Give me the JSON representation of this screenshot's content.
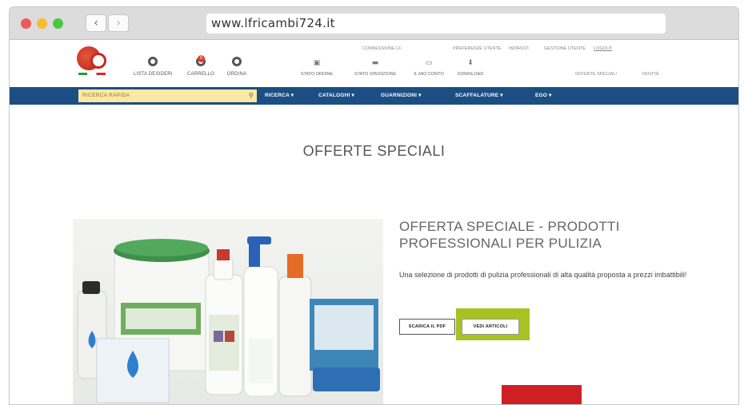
{
  "browser": {
    "url": "www.lfricambi724.it",
    "back_icon": "‹",
    "forward_icon": "›",
    "colors": {
      "close": "#ee5b55",
      "minimize": "#f6bd2f",
      "zoom": "#4bc742"
    }
  },
  "header": {
    "icons": [
      {
        "label": "LISTA DESIDERI"
      },
      {
        "label": "CARRELLO",
        "badge": "0"
      },
      {
        "label": "ORDINA"
      }
    ],
    "status_icons": [
      {
        "label": "STATO ORDINE"
      },
      {
        "label": "STATO SPEDIZIONE"
      },
      {
        "label": "IL MIO CONTO"
      },
      {
        "label": "DOWNLOAD"
      }
    ],
    "top_links": [
      "CONNESSIONE LF",
      "PREFERENZE UTENTE",
      "INDIRIZZI",
      "GESTIONE UTENTE",
      "LOGOUT"
    ],
    "right_links": [
      "OFFERTE SPECIALI",
      "NOVITÀ"
    ]
  },
  "menu": {
    "search_placeholder": "RICERCA RAPIDA",
    "items": [
      "RICERCA ▾",
      "CATALOGHI ▾",
      "GUARNIZIONI ▾",
      "SCAFFALATURE ▾",
      "EGO ▾"
    ],
    "color": "#1b4f83"
  },
  "page": {
    "title": "OFFERTE SPECIALI",
    "offer": {
      "title": "OFFERTA SPECIALE - PRODOTTI PROFESSIONALI PER PULIZIA",
      "description": "Una selezione di prodotti di pulizia professionali di alta qualità proposta a prezzi imbattibili!",
      "pdf_button": "SCARICA IL PDF",
      "view_button": "VEDI ARTICOLI",
      "highlight_color": "#a8c123"
    }
  }
}
